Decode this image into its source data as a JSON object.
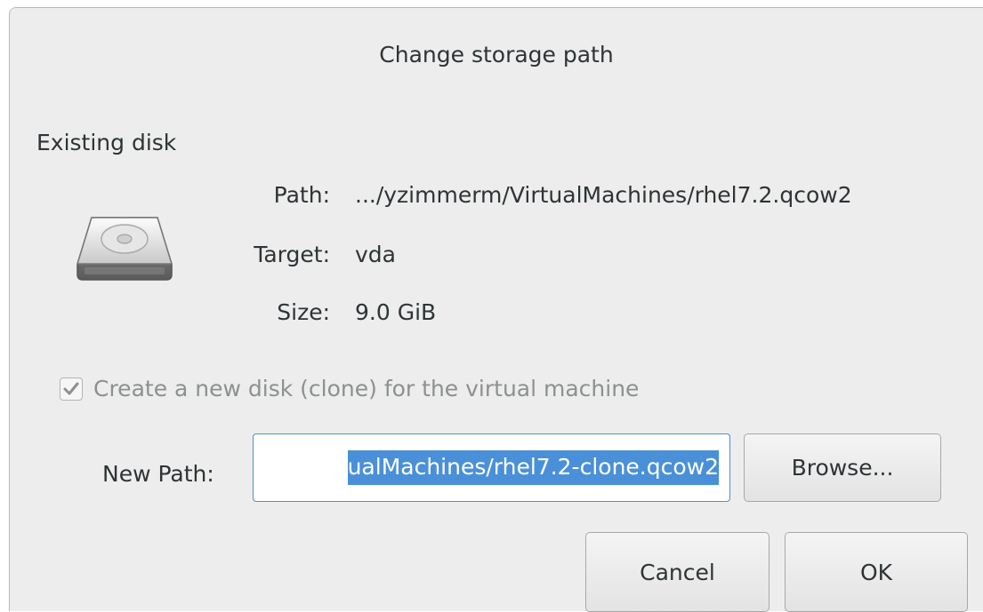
{
  "dialog": {
    "title": "Change storage path"
  },
  "existing_disk": {
    "section_title": "Existing disk",
    "icon": "hard-disk-icon",
    "path_label": "Path:",
    "path_value": ".../yzimmerm/VirtualMachines/rhel7.2.qcow2",
    "target_label": "Target:",
    "target_value": "vda",
    "size_label": "Size:",
    "size_value": "9.0 GiB"
  },
  "clone": {
    "checked": true,
    "enabled": false,
    "label": "Create a new disk (clone) for the virtual machine"
  },
  "new_path": {
    "label": "New Path:",
    "value_visible": "ualMachines/rhel7.2-clone.qcow2",
    "browse_label": "Browse..."
  },
  "actions": {
    "cancel_label": "Cancel",
    "ok_label": "OK"
  },
  "colors": {
    "accent": "#4a90d9",
    "background": "#ededed",
    "disabled_text": "#8d9091"
  }
}
